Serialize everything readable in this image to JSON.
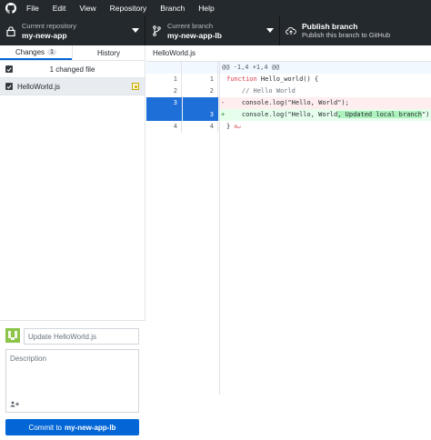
{
  "menu": {
    "items": [
      "File",
      "Edit",
      "View",
      "Repository",
      "Branch",
      "Help"
    ]
  },
  "toolbar": {
    "repo": {
      "label": "Current repository",
      "value": "my-new-app"
    },
    "branch": {
      "label": "Current branch",
      "value": "my-new-app-lb"
    },
    "publish": {
      "title": "Publish branch",
      "subtitle": "Publish this branch to GitHub"
    }
  },
  "tabs": {
    "changes_label": "Changes",
    "changes_count": "1",
    "history_label": "History"
  },
  "changes": {
    "summary": "1 changed file",
    "files": [
      {
        "name": "HelloWorld.js",
        "status": "modified"
      }
    ]
  },
  "commit": {
    "summary_placeholder": "Update HelloWorld.js",
    "description_placeholder": "Description",
    "coauthor_icon": "add-coauthor-icon",
    "button_prefix": "Commit to",
    "button_branch": "my-new-app-lb"
  },
  "diff": {
    "filename": "HelloWorld.js",
    "hunk_header": "@@ -1,4 +1,4 @@",
    "lines": [
      {
        "old": "1",
        "new": "1",
        "type": "context",
        "code": "function Hello_world() {"
      },
      {
        "old": "2",
        "new": "2",
        "type": "context",
        "code": "    // Hello World"
      },
      {
        "old": "3",
        "new": "",
        "type": "del",
        "code": "    console.log(\"Hello, World\");"
      },
      {
        "old": "",
        "new": "3",
        "type": "add",
        "code_before": "    console.log(\"Hello, World",
        "code_highlight": ", Updated local branch",
        "code_after": "\");"
      },
      {
        "old": "4",
        "new": "4",
        "type": "context",
        "code": "}"
      }
    ]
  },
  "colors": {
    "accent": "#0366d6",
    "toolbar_bg": "#24292e",
    "added_bg": "#e6ffed",
    "deleted_bg": "#ffeef0"
  }
}
